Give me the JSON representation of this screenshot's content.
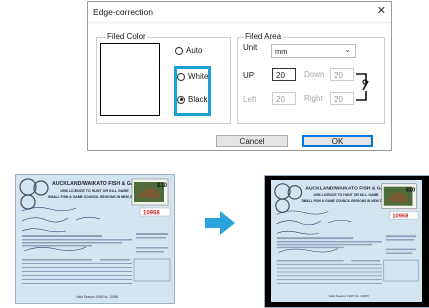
{
  "dialog": {
    "title": "Edge-correction",
    "close_glyph": "✕",
    "filed_color": {
      "label": "Filed Color",
      "options": [
        "Auto",
        "White",
        "Black"
      ],
      "selected": "Black"
    },
    "filed_area": {
      "label": "Filed Area",
      "unit_label": "Unit",
      "unit_value": "mm",
      "up_label": "UP",
      "up_value": "20",
      "down_label": "Down",
      "down_value": "20",
      "left_label": "Left",
      "left_value": "20",
      "right_label": "Right",
      "right_value": "20"
    },
    "cancel_label": "Cancel",
    "ok_label": "OK"
  },
  "document": {
    "header_line1": "AUCKLAND/WAIKATO FISH & GAME COUNCIL",
    "header_line2": "1996 LICENCE TO HUNT OR KILL GAME",
    "header_line3": "SMALL FISH & GAME COUNCIL REGIONS IN NEW ZEALAND",
    "stamp_value": "$10",
    "serial_number": "10968",
    "footer_text": "Valid Season 1996 No. 10968"
  },
  "colors": {
    "accent": "#1d9fd8",
    "ok_border": "#0078d7"
  }
}
